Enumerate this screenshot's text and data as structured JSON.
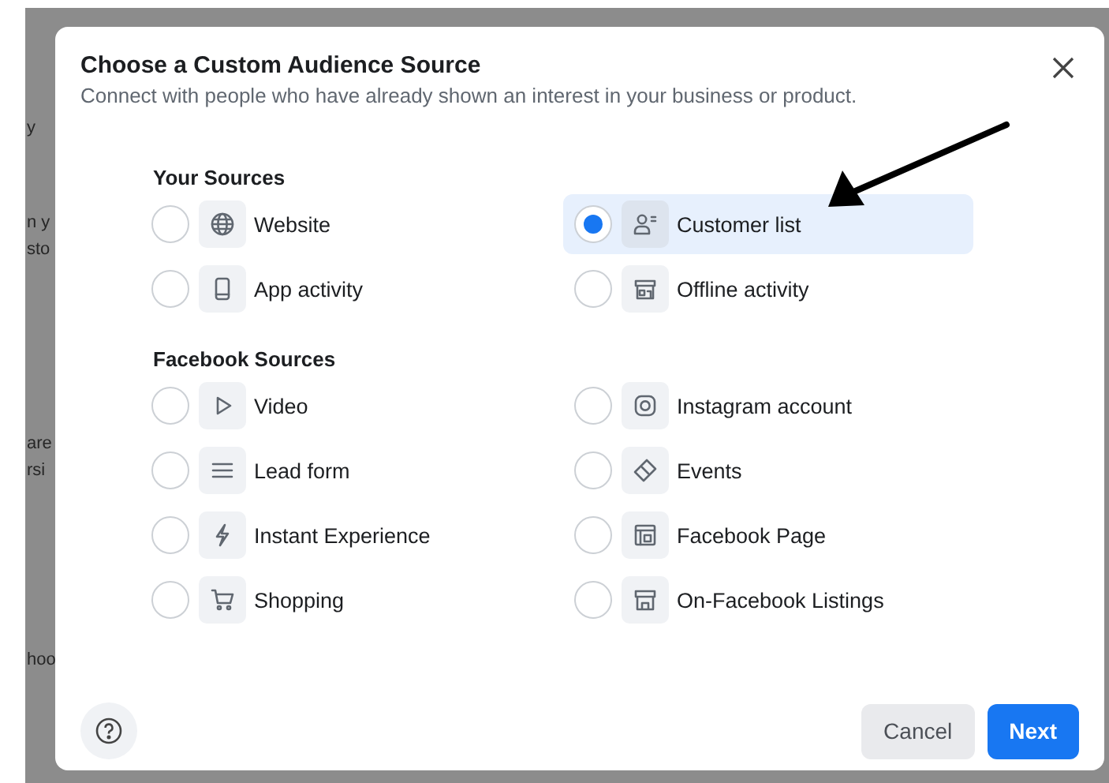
{
  "background_fragments": [
    "y",
    "n y",
    "sto",
    "are",
    "rsi",
    "hoo"
  ],
  "dialog": {
    "title": "Choose a Custom Audience Source",
    "subtitle": "Connect with people who have already shown an interest in your business or product.",
    "sections": [
      {
        "heading": "Your Sources",
        "items": [
          {
            "label": "Website",
            "selected": false
          },
          {
            "label": "Customer list",
            "selected": true
          },
          {
            "label": "App activity",
            "selected": false
          },
          {
            "label": "Offline activity",
            "selected": false
          }
        ]
      },
      {
        "heading": "Facebook Sources",
        "items": [
          {
            "label": "Video",
            "selected": false
          },
          {
            "label": "Instagram account",
            "selected": false
          },
          {
            "label": "Lead form",
            "selected": false
          },
          {
            "label": "Events",
            "selected": false
          },
          {
            "label": "Instant Experience",
            "selected": false
          },
          {
            "label": "Facebook Page",
            "selected": false
          },
          {
            "label": "Shopping",
            "selected": false
          },
          {
            "label": "On-Facebook Listings",
            "selected": false
          }
        ]
      }
    ],
    "buttons": [
      {
        "label": "Cancel",
        "kind": "secondary"
      },
      {
        "label": "Next",
        "kind": "primary"
      }
    ]
  }
}
